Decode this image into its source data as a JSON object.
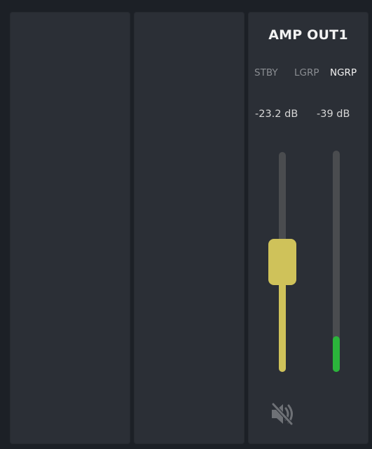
{
  "channels": [
    {},
    {},
    {
      "title": "AMP OUT1",
      "modes": [
        "STBY",
        "LGRP",
        "NGRP"
      ],
      "active_mode": "NGRP",
      "fader_db_label": "-23.2 dB",
      "meter_db_label": "-39 dB",
      "fader_level": 0.5,
      "meter_level": 0.16,
      "mute_icon": "speaker-muted-icon",
      "colors": {
        "fader": "#cfc25a",
        "meter": "#2bb53b",
        "track": "#4a4c4f",
        "active_mode": "#f0f0f0",
        "inactive_mode": "#8a8d92"
      }
    }
  ]
}
